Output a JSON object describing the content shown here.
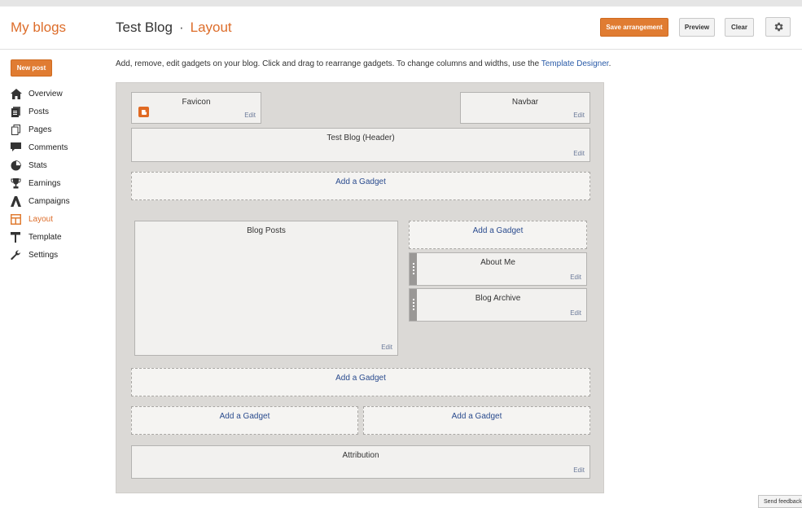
{
  "header": {
    "brand": "My blogs",
    "blog_name": "Test Blog",
    "separator": "·",
    "current_section": "Layout",
    "save_label": "Save arrangement",
    "preview_label": "Preview",
    "clear_label": "Clear",
    "accent_color": "#dd6d2a"
  },
  "sidebar": {
    "new_post_label": "New post",
    "items": [
      {
        "label": "Overview",
        "icon": "home-icon"
      },
      {
        "label": "Posts",
        "icon": "posts-icon"
      },
      {
        "label": "Pages",
        "icon": "pages-icon"
      },
      {
        "label": "Comments",
        "icon": "comment-icon"
      },
      {
        "label": "Stats",
        "icon": "pie-chart-icon"
      },
      {
        "label": "Earnings",
        "icon": "trophy-icon"
      },
      {
        "label": "Campaigns",
        "icon": "campaign-icon"
      },
      {
        "label": "Layout",
        "icon": "layout-icon",
        "active": true
      },
      {
        "label": "Template",
        "icon": "paint-roller-icon"
      },
      {
        "label": "Settings",
        "icon": "wrench-icon"
      }
    ]
  },
  "intro": {
    "text": "Add, remove, edit gadgets on your blog. Click and drag to rearrange gadgets. To change columns and widths, use the",
    "link": "Template Designer",
    "end": "."
  },
  "layout": {
    "edit_label": "Edit",
    "add_gadget_label": "Add a Gadget",
    "favicon": "Favicon",
    "navbar": "Navbar",
    "header": "Test Blog (Header)",
    "blog_posts": "Blog Posts",
    "about_me": "About Me",
    "blog_archive": "Blog Archive",
    "attribution": "Attribution"
  },
  "footer": {
    "feedback_label": "Send feedback"
  }
}
